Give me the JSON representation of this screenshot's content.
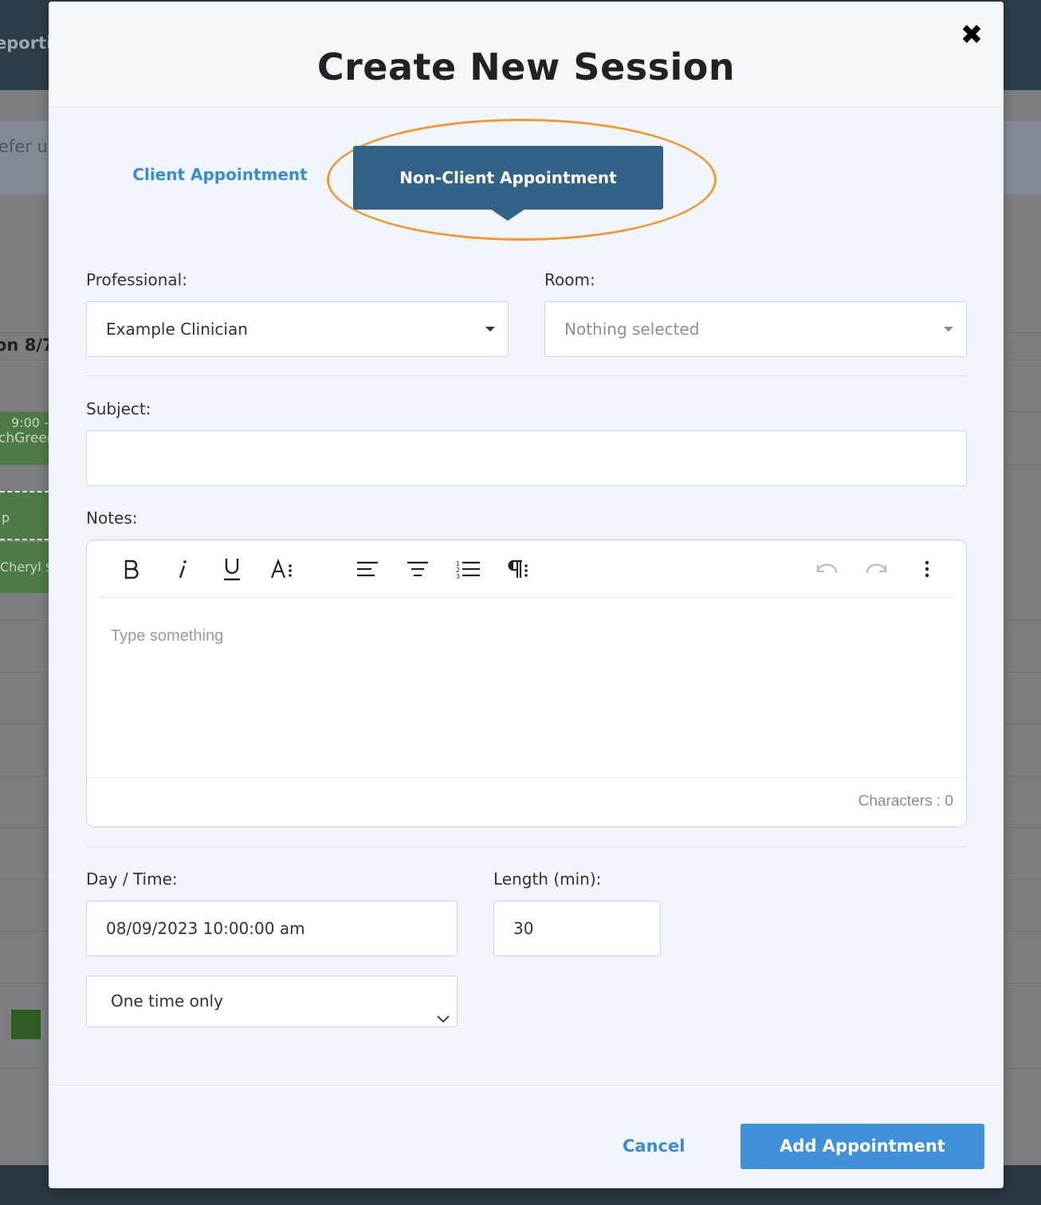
{
  "background": {
    "topbar_text": "eporti",
    "banner_text": "efer us",
    "date_label": "on 8/7",
    "event1_time": "9:00 -",
    "event1_name": "chGreen",
    "event2_text": "p",
    "event3_text": "Cheryl $"
  },
  "modal": {
    "title": "Create New Session",
    "close_glyph": "✖"
  },
  "tabs": {
    "client": "Client Appointment",
    "non_client": "Non-Client Appointment",
    "active": "non_client"
  },
  "form": {
    "professional_label": "Professional:",
    "professional_value": "Example Clinician",
    "room_label": "Room:",
    "room_placeholder": "Nothing selected",
    "subject_label": "Subject:",
    "subject_value": "",
    "notes_label": "Notes:",
    "notes_placeholder": "Type something",
    "characters_count": "Characters : 0",
    "daytime_label": "Day / Time:",
    "daytime_value": "08/09/2023 10:00:00 am",
    "length_label": "Length (min):",
    "length_value": "30",
    "recurrence_value": "One time only"
  },
  "toolbar_icons": [
    "bold-icon",
    "italic-icon",
    "underline-icon",
    "font-size-icon",
    "align-left-icon",
    "align-center-icon",
    "ordered-list-icon",
    "paragraph-icon",
    "undo-icon",
    "redo-icon",
    "more-icon"
  ],
  "footer": {
    "cancel_label": "Cancel",
    "add_label": "Add Appointment"
  },
  "colors": {
    "accent": "#3b8bd0",
    "active_tab": "#346187",
    "highlight_ring": "#ea9b3c",
    "primary_button": "#4191d8"
  }
}
